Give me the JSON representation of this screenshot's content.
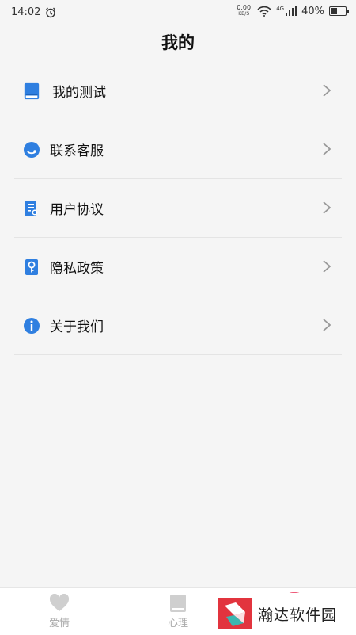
{
  "status_bar": {
    "time": "14:02",
    "net_speed_value": "0.00",
    "net_speed_unit": "KB/S",
    "network_type": "4G",
    "battery": "40%"
  },
  "page": {
    "title": "我的"
  },
  "menu": {
    "items": [
      {
        "label": "我的测试",
        "icon": "book-icon",
        "color": "#2f7fe0"
      },
      {
        "label": "联系客服",
        "icon": "customer-service-icon",
        "color": "#2f7fe0"
      },
      {
        "label": "用户协议",
        "icon": "document-icon",
        "color": "#2f7fe0"
      },
      {
        "label": "隐私政策",
        "icon": "key-icon",
        "color": "#2f7fe0"
      },
      {
        "label": "关于我们",
        "icon": "info-icon",
        "color": "#2f7fe0"
      }
    ]
  },
  "tab_bar": {
    "tabs": [
      {
        "label": "爱情",
        "icon": "heart-icon"
      },
      {
        "label": "心理",
        "icon": "book-icon"
      }
    ]
  },
  "watermark": {
    "text": "瀚达软件园"
  }
}
